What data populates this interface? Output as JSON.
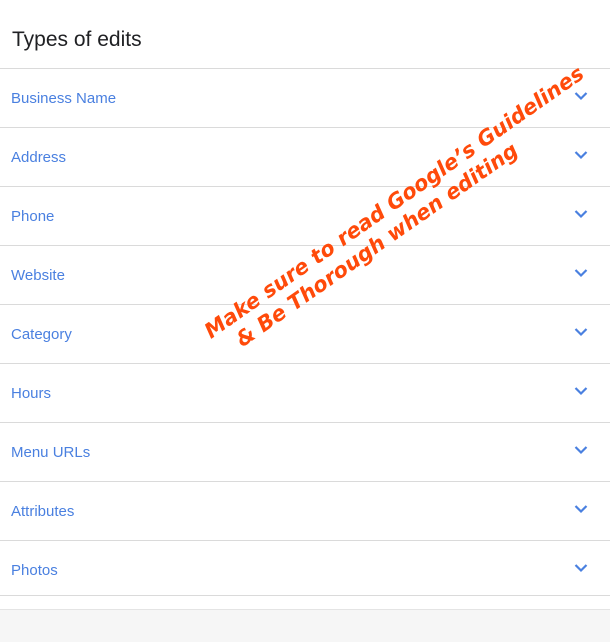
{
  "header": {
    "title": "Types of edits"
  },
  "edit_types": [
    {
      "label": "Business Name",
      "icon": "chevron-down-icon"
    },
    {
      "label": "Address",
      "icon": "chevron-down-icon"
    },
    {
      "label": "Phone",
      "icon": "chevron-down-icon"
    },
    {
      "label": "Website",
      "icon": "chevron-down-icon"
    },
    {
      "label": "Category",
      "icon": "chevron-down-icon"
    },
    {
      "label": "Hours",
      "icon": "chevron-down-icon"
    },
    {
      "label": "Menu URLs",
      "icon": "chevron-down-icon"
    },
    {
      "label": "Attributes",
      "icon": "chevron-down-icon"
    },
    {
      "label": "Photos",
      "icon": "chevron-down-icon"
    }
  ],
  "annotation": {
    "line1": "Make sure to read Google’s Guidelines",
    "line2": "& Be Thorough when editing",
    "color": "#ff4a0a"
  },
  "colors": {
    "accent": "#4a80e0",
    "divider": "#dadada",
    "title": "#202124"
  }
}
